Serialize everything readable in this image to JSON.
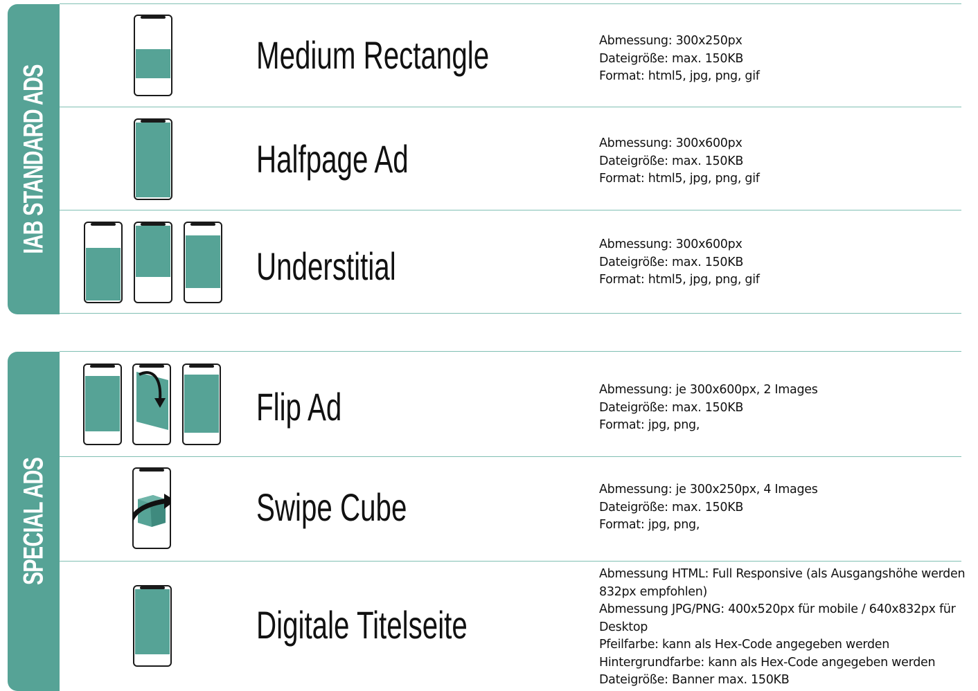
{
  "sections": [
    {
      "label": "IAB STANDARD ADS",
      "ads": [
        {
          "title": "Medium Rectangle",
          "specs": [
            "Abmessung: 300x250px",
            "Dateigröße: max. 150KB",
            "Format: html5, jpg, png, gif"
          ]
        },
        {
          "title": "Halfpage Ad",
          "specs": [
            "Abmessung: 300x600px",
            "Dateigröße: max. 150KB",
            "Format: html5, jpg, png, gif"
          ]
        },
        {
          "title": "Understitial",
          "specs": [
            "Abmessung: 300x600px",
            "Dateigröße: max. 150KB",
            "Format: html5, jpg, png, gif"
          ]
        }
      ]
    },
    {
      "label": "SPECIAL ADS",
      "ads": [
        {
          "title": "Flip Ad",
          "specs": [
            "Abmessung: je 300x600px, 2 Images",
            "Dateigröße: max. 150KB",
            "Format: jpg, png,"
          ]
        },
        {
          "title": "Swipe Cube",
          "specs": [
            "Abmessung: je 300x250px, 4 Images",
            "Dateigröße: max. 150KB",
            "Format: jpg, png,"
          ]
        },
        {
          "title": "Digitale Titelseite",
          "specs": [
            "Abmessung HTML: Full Responsive (als Ausgangshöhe werden",
            "832px empfohlen)",
            "Abmessung JPG/PNG: 400x520px für mobile / 640x832px für",
            "Desktop",
            "Pfeilfarbe: kann als Hex-Code angegeben werden",
            "Hintergrundfarbe: kann als Hex-Code angegeben werden",
            "Dateigröße: Banner max. 150KB"
          ]
        }
      ]
    }
  ],
  "colors": {
    "accent": "#56a396",
    "divider": "#7fbfb3",
    "phone_outline": "#1a1a1a"
  }
}
